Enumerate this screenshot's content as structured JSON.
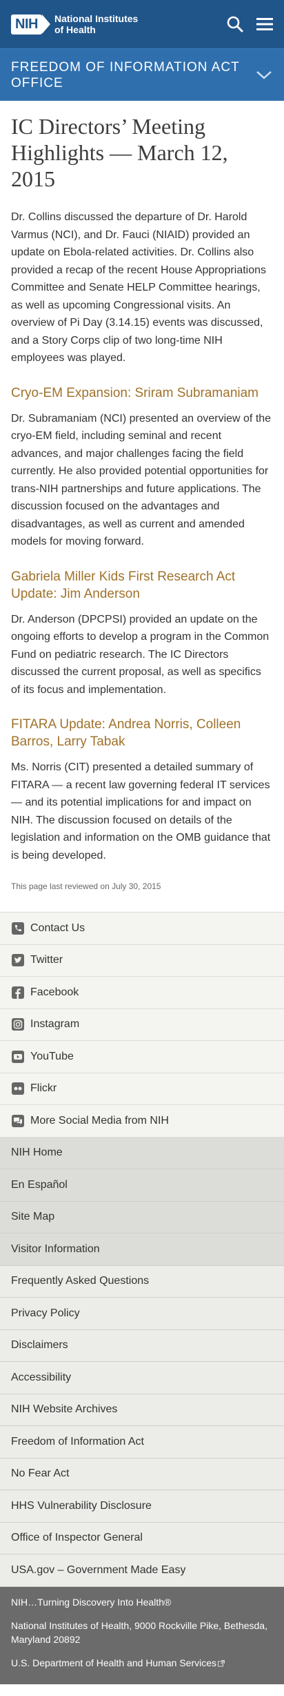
{
  "header": {
    "logo_mark": "NIH",
    "logo_line1": "National Institutes",
    "logo_line2": "of Health",
    "section_title": "Freedom of Information Act Office"
  },
  "article": {
    "title": "IC Directors’ Meeting Highlights — March 12, 2015",
    "intro": "Dr. Collins discussed the departure of Dr. Harold Varmus (NCI), and Dr. Fauci (NIAID) provided an update on Ebola-related activities. Dr. Collins also provided a recap of the recent House Appropriations Committee and Senate HELP Committee hearings, as well as upcoming Congressional visits. An overview of Pi Day (3.14.15) events was discussed, and a Story Corps clip of two long-time NIH employees was played.",
    "sections": [
      {
        "heading": "Cryo-EM Expansion: Sriram Subramaniam",
        "text": "Dr. Subramaniam (NCI) presented an overview of the cryo-EM field, including seminal and recent advances, and major challenges facing the field currently. He also provided potential opportunities for trans-NIH partnerships and future applications. The discussion focused on the advantages and disadvantages, as well as current and amended models for moving forward."
      },
      {
        "heading": "Gabriela Miller Kids First Research Act Update: Jim Anderson",
        "text": "Dr. Anderson (DPCPSI) provided an update on the ongoing efforts to develop a program in the Common Fund on pediatric research. The IC Directors discussed the current proposal, as well as specifics of its focus and implementation."
      },
      {
        "heading": "FITARA Update: Andrea Norris, Colleen Barros, Larry Tabak",
        "text": "Ms. Norris (CIT) presented a detailed summary of FITARA — a recent law governing federal IT services — and its potential implications for and impact on NIH. The discussion focused on details of the legislation and information on the OMB guidance that is being developed."
      }
    ],
    "last_reviewed": "This page last reviewed on July 30, 2015"
  },
  "social": {
    "items": [
      {
        "label": "Contact Us",
        "icon": "phone-icon"
      },
      {
        "label": "Twitter",
        "icon": "twitter-icon"
      },
      {
        "label": "Facebook",
        "icon": "facebook-icon"
      },
      {
        "label": "Instagram",
        "icon": "instagram-icon"
      },
      {
        "label": "YouTube",
        "icon": "youtube-icon"
      },
      {
        "label": "Flickr",
        "icon": "flickr-icon"
      },
      {
        "label": "More Social Media from NIH",
        "icon": "chat-icon"
      }
    ]
  },
  "footer": {
    "links": [
      "NIH Home",
      "En Español",
      "Site Map",
      "Visitor Information",
      "Frequently Asked Questions",
      "Privacy Policy",
      "Disclaimers",
      "Accessibility",
      "NIH Website Archives",
      "Freedom of Information Act",
      "No Fear Act",
      "HHS Vulnerability Disclosure",
      "Office of Inspector General",
      "USA.gov – Government Made Easy"
    ],
    "tagline": "NIH…Turning Discovery Into Health®",
    "address": "National Institutes of Health, 9000 Rockville Pike, Bethesda, Maryland 20892",
    "hhs": "U.S. Department of Health and Human Services"
  },
  "colors": {
    "header_bg": "#20558a",
    "section_bar_bg": "#2f6fae",
    "subheading": "#a0722b",
    "bottom_footer_bg": "#6b6b6b"
  }
}
